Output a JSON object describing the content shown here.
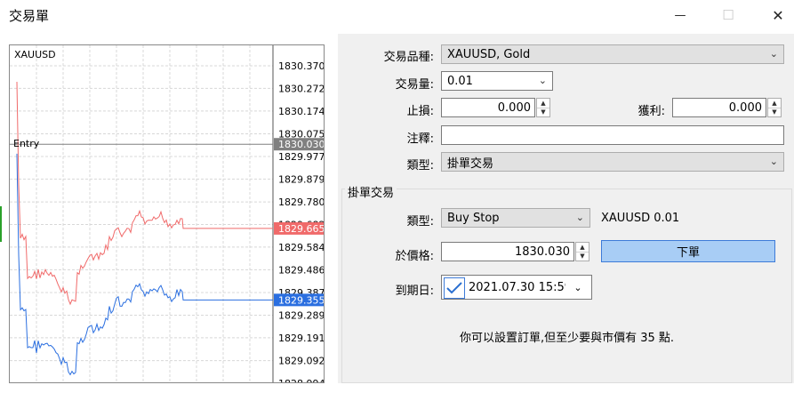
{
  "window": {
    "title": "交易單",
    "minimize_glyph": "—",
    "maximize_glyph": "☐",
    "close_glyph": "✕"
  },
  "chart": {
    "symbol": "XAUUSD",
    "entry_label": "Entry",
    "price_ticks": [
      "1830.370",
      "1830.272",
      "1830.174",
      "1830.075",
      "1829.977",
      "1829.879",
      "1829.780",
      "1829.682",
      "1829.584",
      "1829.486",
      "1829.387",
      "1829.289",
      "1829.191",
      "1829.092",
      "1828.994"
    ],
    "entry_price": "1830.030",
    "ask_price": "1829.665",
    "bid_price": "1829.355",
    "colors": {
      "ask": "#f06a6a",
      "bid": "#2b6fe0",
      "entry_tag": "#808080",
      "grid": "#d8d8d8"
    }
  },
  "form": {
    "symbol_label": "交易品種:",
    "symbol_value": "XAUUSD, Gold",
    "volume_label": "交易量:",
    "volume_value": "0.01",
    "sl_label": "止損:",
    "sl_value": "0.000",
    "tp_label": "獲利:",
    "tp_value": "0.000",
    "comment_label": "注釋:",
    "comment_value": "",
    "type_label": "類型:",
    "type_value": "掛單交易"
  },
  "pending": {
    "group_title": "掛單交易",
    "type_label": "類型:",
    "type_value": "Buy Stop",
    "summary": "XAUUSD 0.01",
    "price_label": "於價格:",
    "price_value": "1830.030",
    "place_button": "下單",
    "expiry_label": "到期日:",
    "expiry_value": "2021.07.30 15:59",
    "info_text": "你可以設置訂單,但至少要與市價有 35 點."
  }
}
